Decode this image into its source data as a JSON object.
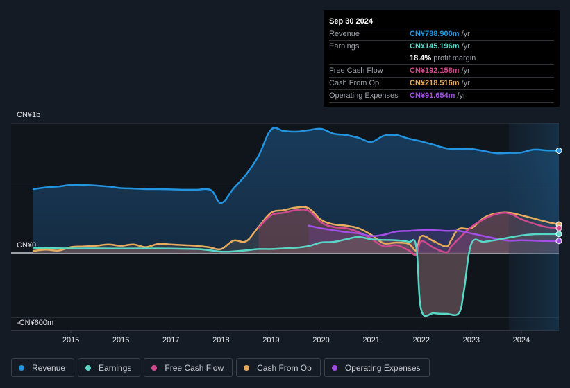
{
  "tooltip": {
    "date": "Sep 30 2024",
    "rows": [
      {
        "label": "Revenue",
        "value": "CN¥788.900m",
        "unit": "/yr",
        "color": "#2394df"
      },
      {
        "label": "Earnings",
        "value": "CN¥145.196m",
        "unit": "/yr",
        "color": "#58d7c6"
      },
      {
        "label": "",
        "value": "18.4%",
        "unit": "profit margin",
        "color": "#ffffff"
      },
      {
        "label": "Free Cash Flow",
        "value": "CN¥192.158m",
        "unit": "/yr",
        "color": "#d0498e"
      },
      {
        "label": "Cash From Op",
        "value": "CN¥218.516m",
        "unit": "/yr",
        "color": "#e9ac5d"
      },
      {
        "label": "Operating Expenses",
        "value": "CN¥91.654m",
        "unit": "/yr",
        "color": "#a34ee6"
      }
    ]
  },
  "legend": [
    {
      "label": "Revenue",
      "color": "#2394df"
    },
    {
      "label": "Earnings",
      "color": "#58d7c6"
    },
    {
      "label": "Free Cash Flow",
      "color": "#d0498e"
    },
    {
      "label": "Cash From Op",
      "color": "#e9ac5d"
    },
    {
      "label": "Operating Expenses",
      "color": "#a34ee6"
    }
  ],
  "chart_data": {
    "type": "area",
    "title": "",
    "xlabel": "",
    "ylabel": "",
    "unit": "CN¥m",
    "ylim": [
      -600,
      1000
    ],
    "xlim": [
      2014.25,
      2024.75
    ],
    "y_tick_labels": [
      "CN¥1b",
      "CN¥0",
      "-CN¥600m"
    ],
    "y_tick_values": [
      1000,
      0,
      -600
    ],
    "gridlines": [
      1000,
      500,
      0,
      -500
    ],
    "x_tick_labels": [
      "2015",
      "2016",
      "2017",
      "2018",
      "2019",
      "2020",
      "2021",
      "2022",
      "2023",
      "2024"
    ],
    "x_tick_values": [
      2015,
      2016,
      2017,
      2018,
      2019,
      2020,
      2021,
      2022,
      2023,
      2024
    ],
    "highlight_range": [
      2023.75,
      2024.75
    ],
    "series": [
      {
        "name": "Revenue",
        "color": "#2394df",
        "points": [
          [
            2014.25,
            492
          ],
          [
            2014.5,
            505
          ],
          [
            2014.75,
            512
          ],
          [
            2015,
            524
          ],
          [
            2015.25,
            524
          ],
          [
            2015.5,
            519
          ],
          [
            2015.75,
            512
          ],
          [
            2016,
            500
          ],
          [
            2016.25,
            497
          ],
          [
            2016.5,
            492
          ],
          [
            2016.75,
            492
          ],
          [
            2017,
            490
          ],
          [
            2017.25,
            487
          ],
          [
            2017.5,
            487
          ],
          [
            2017.8,
            484
          ],
          [
            2018,
            385
          ],
          [
            2018.25,
            497
          ],
          [
            2018.5,
            605
          ],
          [
            2018.75,
            749
          ],
          [
            2019,
            952
          ],
          [
            2019.25,
            941
          ],
          [
            2019.5,
            936
          ],
          [
            2019.75,
            947
          ],
          [
            2020,
            957
          ],
          [
            2020.25,
            920
          ],
          [
            2020.5,
            909
          ],
          [
            2020.75,
            888
          ],
          [
            2021,
            856
          ],
          [
            2021.25,
            904
          ],
          [
            2021.5,
            909
          ],
          [
            2021.75,
            882
          ],
          [
            2022,
            860
          ],
          [
            2022.25,
            834
          ],
          [
            2022.5,
            807
          ],
          [
            2022.75,
            802
          ],
          [
            2023,
            802
          ],
          [
            2023.25,
            786
          ],
          [
            2023.5,
            770
          ],
          [
            2023.75,
            772
          ],
          [
            2024,
            775
          ],
          [
            2024.25,
            797
          ],
          [
            2024.5,
            791
          ],
          [
            2024.75,
            789
          ]
        ]
      },
      {
        "name": "Earnings",
        "color": "#58d7c6",
        "points": [
          [
            2014.25,
            40
          ],
          [
            2014.5,
            38
          ],
          [
            2015,
            35
          ],
          [
            2015.5,
            35
          ],
          [
            2016,
            33
          ],
          [
            2016.5,
            35
          ],
          [
            2017,
            33
          ],
          [
            2017.5,
            30
          ],
          [
            2017.75,
            22
          ],
          [
            2018,
            10
          ],
          [
            2018.25,
            12
          ],
          [
            2018.5,
            20
          ],
          [
            2018.75,
            30
          ],
          [
            2019,
            30
          ],
          [
            2019.25,
            35
          ],
          [
            2019.5,
            40
          ],
          [
            2019.75,
            53
          ],
          [
            2020,
            80
          ],
          [
            2020.25,
            85
          ],
          [
            2020.5,
            105
          ],
          [
            2020.75,
            123
          ],
          [
            2021,
            105
          ],
          [
            2021.25,
            100
          ],
          [
            2021.5,
            98
          ],
          [
            2021.75,
            85
          ],
          [
            2021.9,
            50
          ],
          [
            2022,
            -440
          ],
          [
            2022.25,
            -465
          ],
          [
            2022.5,
            -470
          ],
          [
            2022.75,
            -465
          ],
          [
            2022.85,
            -300
          ],
          [
            2023,
            70
          ],
          [
            2023.25,
            85
          ],
          [
            2023.5,
            100
          ],
          [
            2023.75,
            118
          ],
          [
            2024,
            134
          ],
          [
            2024.25,
            144
          ],
          [
            2024.5,
            145
          ],
          [
            2024.75,
            145
          ]
        ]
      },
      {
        "name": "Free Cash Flow",
        "color": "#d0498e",
        "points": [
          [
            2018.75,
            195
          ],
          [
            2019,
            290
          ],
          [
            2019.25,
            310
          ],
          [
            2019.5,
            330
          ],
          [
            2019.75,
            325
          ],
          [
            2020,
            235
          ],
          [
            2020.25,
            200
          ],
          [
            2020.5,
            190
          ],
          [
            2020.75,
            160
          ],
          [
            2021,
            110
          ],
          [
            2021.25,
            50
          ],
          [
            2021.5,
            60
          ],
          [
            2021.75,
            20
          ],
          [
            2021.9,
            -15
          ],
          [
            2022,
            90
          ],
          [
            2022.25,
            40
          ],
          [
            2022.5,
            5
          ],
          [
            2022.6,
            50
          ],
          [
            2022.75,
            110
          ],
          [
            2023,
            200
          ],
          [
            2023.25,
            260
          ],
          [
            2023.5,
            300
          ],
          [
            2023.75,
            305
          ],
          [
            2024,
            260
          ],
          [
            2024.25,
            225
          ],
          [
            2024.5,
            200
          ],
          [
            2024.75,
            192
          ]
        ]
      },
      {
        "name": "Cash From Op",
        "color": "#e9ac5d",
        "points": [
          [
            2014.25,
            15
          ],
          [
            2014.5,
            25
          ],
          [
            2014.75,
            18
          ],
          [
            2015,
            45
          ],
          [
            2015.25,
            50
          ],
          [
            2015.5,
            55
          ],
          [
            2015.75,
            65
          ],
          [
            2016,
            55
          ],
          [
            2016.25,
            65
          ],
          [
            2016.5,
            45
          ],
          [
            2016.75,
            70
          ],
          [
            2017,
            65
          ],
          [
            2017.25,
            60
          ],
          [
            2017.5,
            55
          ],
          [
            2017.75,
            45
          ],
          [
            2018,
            30
          ],
          [
            2018.25,
            95
          ],
          [
            2018.5,
            90
          ],
          [
            2018.75,
            200
          ],
          [
            2019,
            310
          ],
          [
            2019.25,
            330
          ],
          [
            2019.5,
            350
          ],
          [
            2019.75,
            345
          ],
          [
            2020,
            255
          ],
          [
            2020.25,
            220
          ],
          [
            2020.5,
            210
          ],
          [
            2020.75,
            190
          ],
          [
            2021,
            140
          ],
          [
            2021.25,
            75
          ],
          [
            2021.5,
            80
          ],
          [
            2021.75,
            70
          ],
          [
            2021.9,
            20
          ],
          [
            2022,
            130
          ],
          [
            2022.25,
            90
          ],
          [
            2022.5,
            50
          ],
          [
            2022.6,
            100
          ],
          [
            2022.75,
            185
          ],
          [
            2023,
            190
          ],
          [
            2023.25,
            270
          ],
          [
            2023.5,
            305
          ],
          [
            2023.75,
            310
          ],
          [
            2024,
            290
          ],
          [
            2024.25,
            265
          ],
          [
            2024.5,
            240
          ],
          [
            2024.75,
            219
          ]
        ]
      },
      {
        "name": "Operating Expenses",
        "color": "#a34ee6",
        "points": [
          [
            2019.75,
            210
          ],
          [
            2020,
            190
          ],
          [
            2020.25,
            175
          ],
          [
            2020.5,
            160
          ],
          [
            2020.75,
            150
          ],
          [
            2021,
            130
          ],
          [
            2021.25,
            140
          ],
          [
            2021.5,
            165
          ],
          [
            2021.75,
            170
          ],
          [
            2022,
            175
          ],
          [
            2022.25,
            175
          ],
          [
            2022.5,
            170
          ],
          [
            2022.75,
            170
          ],
          [
            2023,
            150
          ],
          [
            2023.25,
            130
          ],
          [
            2023.5,
            110
          ],
          [
            2023.75,
            95
          ],
          [
            2024,
            98
          ],
          [
            2024.25,
            95
          ],
          [
            2024.5,
            92
          ],
          [
            2024.75,
            92
          ]
        ]
      }
    ]
  }
}
